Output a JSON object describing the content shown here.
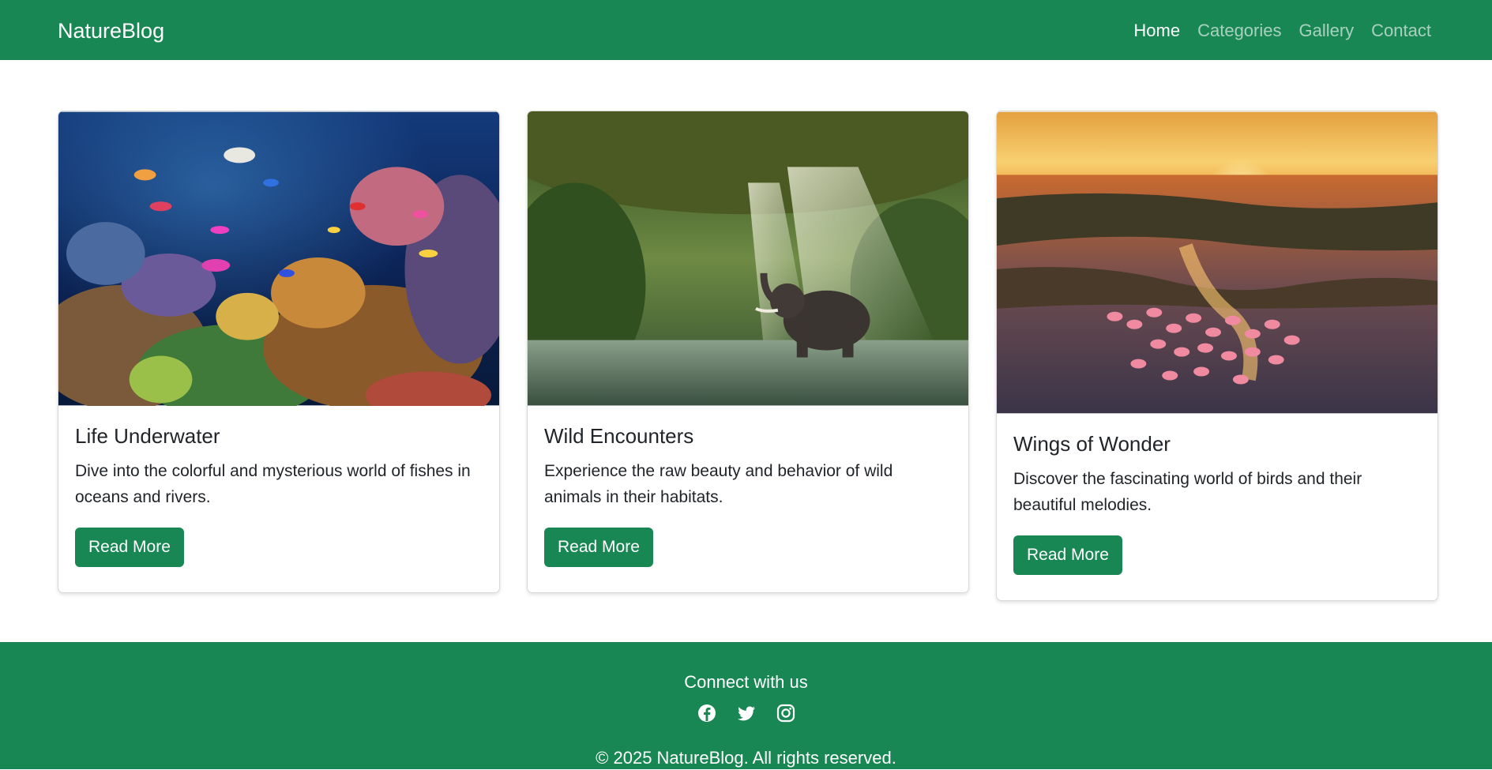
{
  "brand": "NatureBlog",
  "nav": {
    "items": [
      "Home",
      "Categories",
      "Gallery",
      "Contact"
    ],
    "active": "Home"
  },
  "cards": [
    {
      "image_alt": "Coral reef with colorful fish",
      "title": "Life Underwater",
      "text": "Dive into the colorful and mysterious world of fishes in oceans and rivers.",
      "button": "Read More"
    },
    {
      "image_alt": "Elephant standing in a forest river",
      "title": "Wild Encounters",
      "text": "Experience the raw beauty and behavior of wild animals in their habitats.",
      "button": "Read More"
    },
    {
      "image_alt": "Flamingos in water at sunset",
      "title": "Wings of Wonder",
      "text": "Discover the fascinating world of birds and their beautiful melodies.",
      "button": "Read More"
    }
  ],
  "footer": {
    "heading": "Connect with us",
    "social": [
      "facebook-icon",
      "twitter-icon",
      "instagram-icon"
    ],
    "copyright": "© 2025 NatureBlog. All rights reserved."
  },
  "colors": {
    "primary": "#198754",
    "text": "#212529"
  }
}
